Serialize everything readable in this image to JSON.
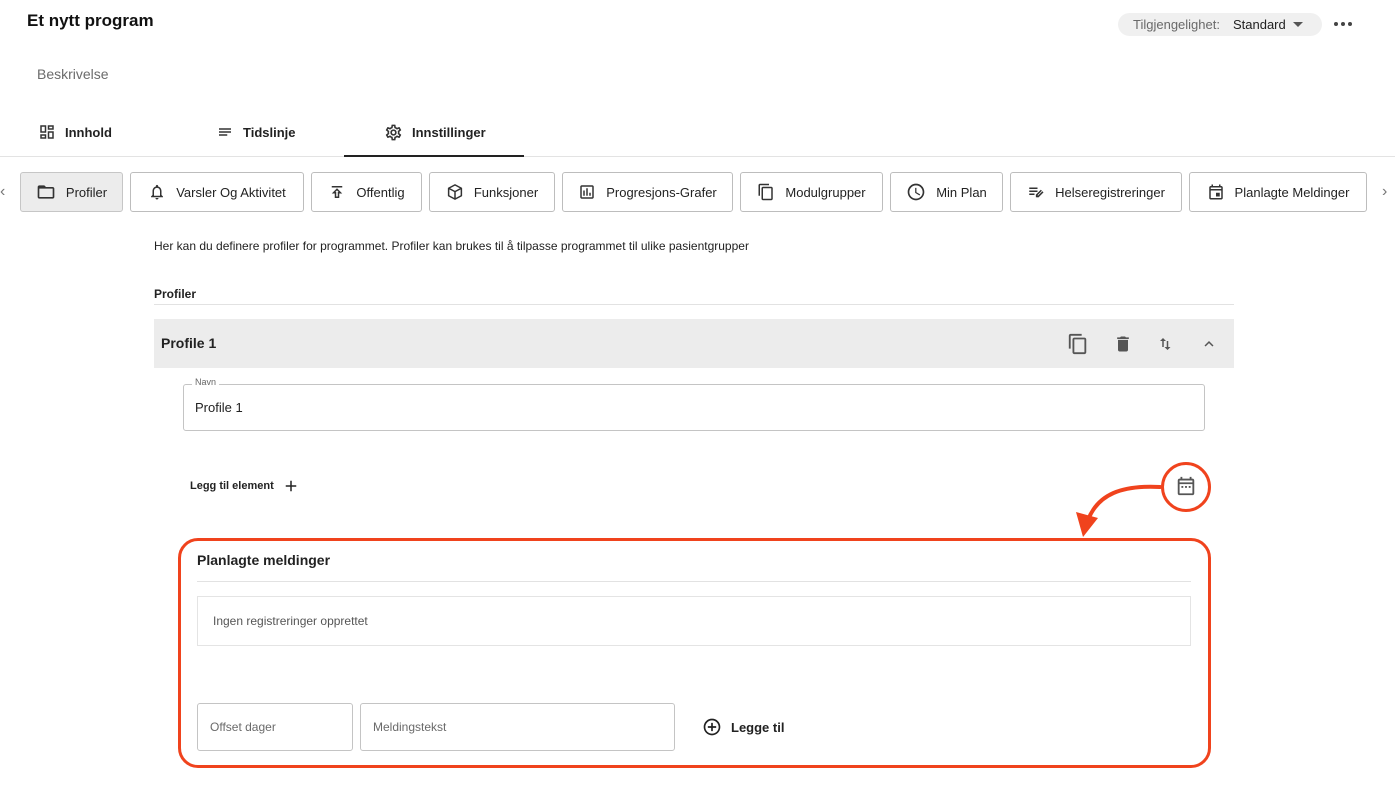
{
  "header": {
    "title": "Et nytt program",
    "availability_label": "Tilgjengelighet:",
    "availability_value": "Standard",
    "description_placeholder": "Beskrivelse"
  },
  "main_tabs": [
    {
      "label": "Innhold",
      "icon": "dashboard-icon",
      "active": false
    },
    {
      "label": "Tidslinje",
      "icon": "lines-icon",
      "active": false
    },
    {
      "label": "Innstillinger",
      "icon": "gear-icon",
      "active": true
    }
  ],
  "sub_tabs": [
    {
      "label": "Profiler",
      "icon": "folder-icon",
      "active": true
    },
    {
      "label": "Varsler Og Aktivitet",
      "icon": "bell-icon",
      "active": false
    },
    {
      "label": "Offentlig",
      "icon": "publish-icon",
      "active": false
    },
    {
      "label": "Funksjoner",
      "icon": "cube-icon",
      "active": false
    },
    {
      "label": "Progresjons-Grafer",
      "icon": "bar-chart-icon",
      "active": false
    },
    {
      "label": "Modulgrupper",
      "icon": "copy-icon",
      "active": false
    },
    {
      "label": "Min Plan",
      "icon": "clock-icon",
      "active": false
    },
    {
      "label": "Helseregistreringer",
      "icon": "edit-list-icon",
      "active": false
    },
    {
      "label": "Planlagte Meldinger",
      "icon": "calendar-icon",
      "active": false
    }
  ],
  "intro_text": "Her kan du definere profiler for programmet. Profiler kan brukes til å tilpasse programmet til ulike pasientgrupper",
  "profiles": {
    "heading": "Profiler",
    "profile": {
      "name": "Profile 1",
      "name_field_label": "Navn",
      "name_field_value": "Profile 1",
      "add_element_label": "Legg til element"
    }
  },
  "scheduled_messages": {
    "title": "Planlagte meldinger",
    "empty_text": "Ingen registreringer opprettet",
    "offset_placeholder": "Offset dager",
    "message_placeholder": "Meldingstekst",
    "add_label": "Legge til"
  },
  "colors": {
    "highlight": "#f0431d",
    "active_chip_bg": "#ececec",
    "profile_bar_bg": "#ececec"
  }
}
